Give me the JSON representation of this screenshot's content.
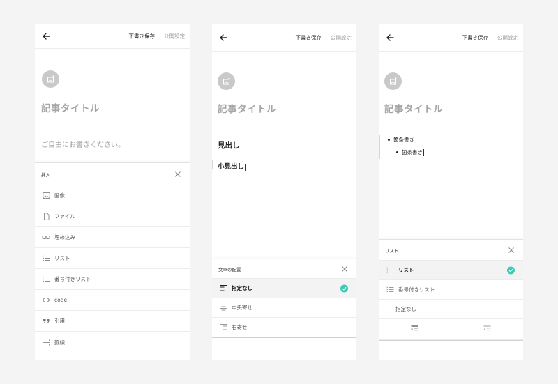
{
  "toolbar": {
    "save_label": "下書き保存",
    "publish_label": "公開設定"
  },
  "editor": {
    "title_placeholder": "記事タイトル",
    "body_placeholder": "ご自由にお書きください。",
    "heading": "見出し",
    "subheading": "小見出し",
    "bullet_1": "箇条書き",
    "bullet_2": "箇条書き"
  },
  "insert_sheet": {
    "title": "挿入",
    "items": [
      {
        "label": "画像",
        "icon": "image-icon"
      },
      {
        "label": "ファイル",
        "icon": "file-icon"
      },
      {
        "label": "埋め込み",
        "icon": "link-icon"
      },
      {
        "label": "リスト",
        "icon": "list-icon"
      },
      {
        "label": "番号付きリスト",
        "icon": "list-icon"
      },
      {
        "label": "code",
        "icon": "code-icon"
      },
      {
        "label": "引用",
        "icon": "quote-icon"
      },
      {
        "label": "罫線",
        "icon": "divider-icon"
      }
    ]
  },
  "align_sheet": {
    "title": "文章の配置",
    "items": [
      {
        "label": "指定なし",
        "icon": "align-left-icon",
        "selected": true
      },
      {
        "label": "中央寄せ",
        "icon": "align-center-icon",
        "selected": false
      },
      {
        "label": "右寄せ",
        "icon": "align-right-icon",
        "selected": false
      }
    ]
  },
  "list_sheet": {
    "title": "リスト",
    "items": [
      {
        "label": "リスト",
        "icon": "list-icon",
        "selected": true
      },
      {
        "label": "番号付きリスト",
        "icon": "list-icon",
        "selected": false
      },
      {
        "label": "指定なし",
        "icon": "",
        "selected": false
      }
    ],
    "indent_buttons": [
      "indent-increase-icon",
      "indent-decrease-icon"
    ]
  },
  "colors": {
    "accent": "#41c9b4",
    "placeholder": "#a5a5a5",
    "background": "#f3f4f3"
  }
}
